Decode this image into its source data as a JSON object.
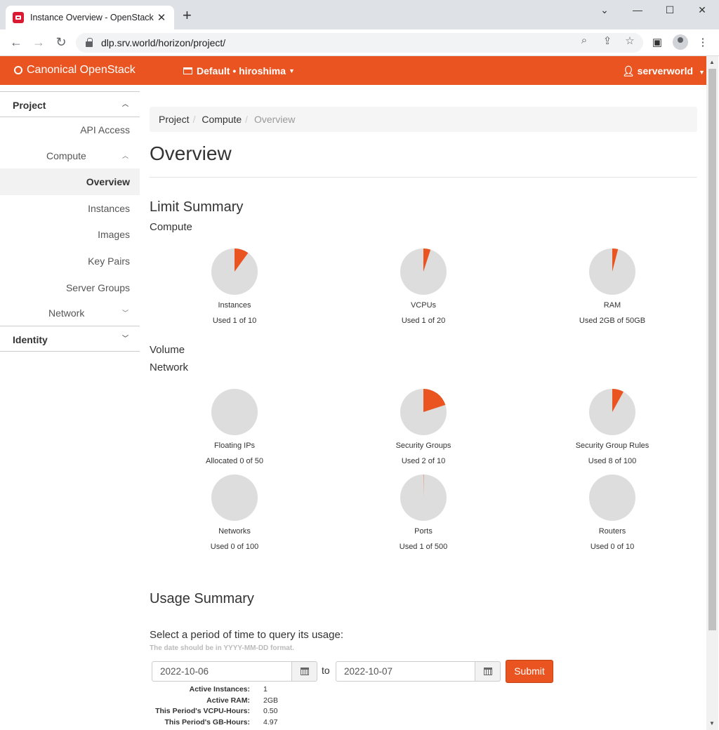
{
  "browser": {
    "tab_title": "Instance Overview - OpenStack D",
    "new_tab": "+",
    "url": "dlp.srv.world/horizon/project/"
  },
  "header": {
    "brand": "Canonical OpenStack",
    "project": "Default • hiroshima",
    "user": "serverworld"
  },
  "sidebar": {
    "project_label": "Project",
    "api_access": "API Access",
    "compute_label": "Compute",
    "compute_items": [
      "Overview",
      "Instances",
      "Images",
      "Key Pairs",
      "Server Groups"
    ],
    "network_label": "Network",
    "identity_label": "Identity"
  },
  "breadcrumb": [
    "Project",
    "Compute",
    "Overview"
  ],
  "page_title": "Overview",
  "limit_summary": {
    "title": "Limit Summary",
    "compute_label": "Compute",
    "volume_label": "Volume",
    "network_label": "Network",
    "compute": [
      {
        "name": "Instances",
        "text": "Used 1 of 10",
        "used": 1,
        "total": 10
      },
      {
        "name": "VCPUs",
        "text": "Used 1 of 20",
        "used": 1,
        "total": 20
      },
      {
        "name": "RAM",
        "text": "Used 2GB of 50GB",
        "used": 2,
        "total": 50
      }
    ],
    "network": [
      {
        "name": "Floating IPs",
        "text": "Allocated 0 of 50",
        "used": 0,
        "total": 50
      },
      {
        "name": "Security Groups",
        "text": "Used 2 of 10",
        "used": 2,
        "total": 10
      },
      {
        "name": "Security Group Rules",
        "text": "Used 8 of 100",
        "used": 8,
        "total": 100
      },
      {
        "name": "Networks",
        "text": "Used 0 of 100",
        "used": 0,
        "total": 100
      },
      {
        "name": "Ports",
        "text": "Used 1 of 500",
        "used": 1,
        "total": 500
      },
      {
        "name": "Routers",
        "text": "Used 0 of 10",
        "used": 0,
        "total": 10
      }
    ],
    "colors": {
      "used": "#e95420",
      "free": "#dddddd"
    }
  },
  "usage_summary": {
    "title": "Usage Summary",
    "query_label": "Select a period of time to query its usage:",
    "help_text": "The date should be in YYYY-MM-DD format.",
    "start_date": "2022-10-06",
    "to_label": "to",
    "end_date": "2022-10-07",
    "submit_label": "Submit",
    "stats": [
      {
        "key": "Active Instances:",
        "value": "1"
      },
      {
        "key": "Active RAM:",
        "value": "2GB"
      },
      {
        "key": "This Period's VCPU-Hours:",
        "value": "0.50"
      },
      {
        "key": "This Period's GB-Hours:",
        "value": "4.97"
      }
    ]
  }
}
